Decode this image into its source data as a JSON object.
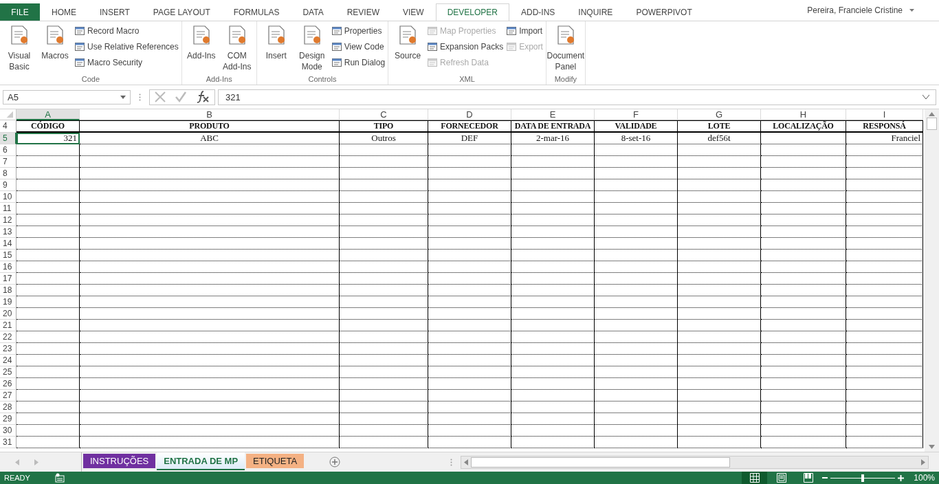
{
  "tabs": [
    {
      "label": "FILE",
      "kind": "file",
      "selected": false
    },
    {
      "label": "HOME",
      "kind": "tab",
      "selected": false
    },
    {
      "label": "INSERT",
      "kind": "tab",
      "selected": false
    },
    {
      "label": "PAGE LAYOUT",
      "kind": "tab",
      "selected": false
    },
    {
      "label": "FORMULAS",
      "kind": "tab",
      "selected": false
    },
    {
      "label": "DATA",
      "kind": "tab",
      "selected": false
    },
    {
      "label": "REVIEW",
      "kind": "tab",
      "selected": false
    },
    {
      "label": "VIEW",
      "kind": "tab",
      "selected": false
    },
    {
      "label": "DEVELOPER",
      "kind": "tab",
      "selected": true
    },
    {
      "label": "ADD-INS",
      "kind": "tab",
      "selected": false
    },
    {
      "label": "INQUIRE",
      "kind": "tab",
      "selected": false
    },
    {
      "label": "POWERPIVOT",
      "kind": "tab",
      "selected": false
    }
  ],
  "user": "Pereira, Franciele Cristine",
  "ribbon": [
    {
      "name": "Code",
      "items": [
        {
          "label": "Visual Basic",
          "kind": "large",
          "disabled": false
        },
        {
          "label": "Macros",
          "kind": "large",
          "disabled": false
        },
        {
          "kind": "stack",
          "items": [
            {
              "label": "Record Macro",
              "disabled": false
            },
            {
              "label": "Use Relative References",
              "disabled": false
            },
            {
              "label": "Macro Security",
              "disabled": false
            }
          ]
        }
      ]
    },
    {
      "name": "Add-Ins",
      "items": [
        {
          "label": "Add-Ins",
          "kind": "large",
          "disabled": false
        },
        {
          "label": "COM Add-Ins",
          "kind": "large",
          "disabled": false
        }
      ]
    },
    {
      "name": "Controls",
      "items": [
        {
          "label": "Insert",
          "kind": "large",
          "disabled": false
        },
        {
          "label": "Design Mode",
          "kind": "large",
          "disabled": false
        },
        {
          "kind": "stack",
          "items": [
            {
              "label": "Properties",
              "disabled": false
            },
            {
              "label": "View Code",
              "disabled": false
            },
            {
              "label": "Run Dialog",
              "disabled": false
            }
          ]
        }
      ]
    },
    {
      "name": "XML",
      "items": [
        {
          "label": "Source",
          "kind": "large",
          "disabled": false
        },
        {
          "kind": "stack",
          "items": [
            {
              "label": "Map Properties",
              "disabled": true
            },
            {
              "label": "Expansion Packs",
              "disabled": false
            },
            {
              "label": "Refresh Data",
              "disabled": true
            }
          ]
        },
        {
          "kind": "stack",
          "items": [
            {
              "label": "Import",
              "disabled": false
            },
            {
              "label": "Export",
              "disabled": true
            }
          ]
        }
      ]
    },
    {
      "name": "Modify",
      "items": [
        {
          "label": "Document Panel",
          "kind": "large",
          "disabled": false
        }
      ]
    }
  ],
  "name_box": "A5",
  "formula": "321",
  "columns": [
    {
      "letter": "A",
      "selected": true
    },
    {
      "letter": "B",
      "selected": false
    },
    {
      "letter": "C",
      "selected": false
    },
    {
      "letter": "D",
      "selected": false
    },
    {
      "letter": "E",
      "selected": false
    },
    {
      "letter": "F",
      "selected": false
    },
    {
      "letter": "G",
      "selected": false
    },
    {
      "letter": "H",
      "selected": false
    },
    {
      "letter": "I",
      "selected": false
    }
  ],
  "rows": [
    {
      "number": "4",
      "kind": "header",
      "selected": false,
      "cells": [
        "CÓDIGO",
        "PRODUTO",
        "TIPO",
        "FORNECEDOR",
        "DATA DE ENTRADA",
        "VALIDADE",
        "LOTE",
        "LOCALIZAÇÃO",
        "RESPONSÁ"
      ]
    },
    {
      "number": "5",
      "kind": "data",
      "selected": true,
      "cells": [
        "321",
        "ABC",
        "Outros",
        "DEF",
        "2-mar-16",
        "8-set-16",
        "def56t",
        "",
        "Franciel"
      ]
    },
    {
      "number": "6",
      "kind": "data",
      "selected": false
    },
    {
      "number": "7",
      "kind": "data",
      "selected": false
    },
    {
      "number": "8",
      "kind": "data",
      "selected": false
    },
    {
      "number": "9",
      "kind": "data",
      "selected": false
    },
    {
      "number": "10",
      "kind": "data",
      "selected": false
    },
    {
      "number": "11",
      "kind": "data",
      "selected": false
    },
    {
      "number": "12",
      "kind": "data",
      "selected": false
    },
    {
      "number": "13",
      "kind": "data",
      "selected": false
    },
    {
      "number": "14",
      "kind": "data",
      "selected": false
    },
    {
      "number": "15",
      "kind": "data",
      "selected": false
    },
    {
      "number": "16",
      "kind": "data",
      "selected": false
    },
    {
      "number": "17",
      "kind": "data",
      "selected": false
    },
    {
      "number": "18",
      "kind": "data",
      "selected": false
    },
    {
      "number": "19",
      "kind": "data",
      "selected": false
    },
    {
      "number": "20",
      "kind": "data",
      "selected": false
    },
    {
      "number": "21",
      "kind": "data",
      "selected": false
    },
    {
      "number": "22",
      "kind": "data",
      "selected": false
    },
    {
      "number": "23",
      "kind": "data",
      "selected": false
    },
    {
      "number": "24",
      "kind": "data",
      "selected": false
    },
    {
      "number": "25",
      "kind": "data",
      "selected": false
    },
    {
      "number": "26",
      "kind": "data",
      "selected": false
    },
    {
      "number": "27",
      "kind": "data",
      "selected": false
    },
    {
      "number": "28",
      "kind": "data",
      "selected": false
    },
    {
      "number": "29",
      "kind": "data",
      "selected": false
    },
    {
      "number": "30",
      "kind": "data",
      "selected": false
    },
    {
      "number": "31",
      "kind": "data",
      "selected": false
    }
  ],
  "sheets": [
    {
      "label": "INSTRUÇÕES",
      "color": "#7030a0",
      "selected": false
    },
    {
      "label": "ENTRADA DE MP",
      "color": "#ddebf7",
      "selected": true
    },
    {
      "label": "ETIQUETA",
      "color": "#f4b183",
      "selected": false
    }
  ],
  "status": {
    "text": "READY",
    "views": [
      {
        "selected": true
      },
      {
        "selected": false
      },
      {
        "selected": false
      }
    ],
    "zoom": {
      "level": 0.5
    },
    "zoom_label": "100%"
  }
}
